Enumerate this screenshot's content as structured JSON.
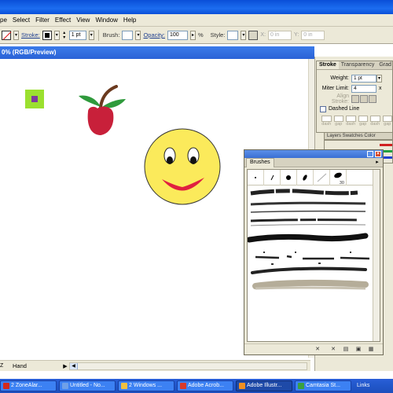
{
  "menu": [
    "pe",
    "Select",
    "Filter",
    "Effect",
    "View",
    "Window",
    "Help"
  ],
  "control_bar": {
    "stroke_label": "Stroke:",
    "stroke_weight": "1 pt",
    "brush_label": "Brush:",
    "opacity_label": "Opacity:",
    "opacity_value": "100",
    "opacity_unit": "%",
    "style_label": "Style:",
    "x_label": "X:",
    "x_value": "0 in",
    "y_label": "Y:",
    "y_value": "0 in"
  },
  "document": {
    "title": "0% (RGB/Preview)"
  },
  "status": {
    "zoom": "Z",
    "tool": "Hand"
  },
  "stroke_panel": {
    "tabs": [
      "Stroke",
      "Transparency",
      "Grad"
    ],
    "weight_label": "Weight:",
    "weight_value": "1 pt",
    "miter_label": "Miter Limit:",
    "miter_value": "4",
    "miter_unit": "x",
    "align_label": "Align Stroke:",
    "dashed_label": "Dashed Line",
    "dash_labels": [
      "dash",
      "gap",
      "dash",
      "gap",
      "dash",
      "gap"
    ]
  },
  "color_strip": {
    "label": "Layers  Swatches  Color"
  },
  "brushes_panel": {
    "tab": "Brushes",
    "first_calligraphic_size": "30",
    "menu_icon": "panel-menu-icon"
  },
  "taskbar": {
    "tasks": [
      {
        "label": "2 ZoneAlar...",
        "color": "#d32a1c",
        "active": false
      },
      {
        "label": "Untitled - No...",
        "color": "#6fa0e8",
        "active": false
      },
      {
        "label": "2 Windows ...",
        "color": "#f0c040",
        "active": false
      },
      {
        "label": "Adobe Acrob...",
        "color": "#d83a2a",
        "active": false
      },
      {
        "label": "Adobe Illustr...",
        "color": "#f09020",
        "active": true
      },
      {
        "label": "Camtasia St...",
        "color": "#3aa040",
        "active": false
      },
      {
        "label": "Links",
        "color": "#6fa0e8",
        "active": false
      }
    ]
  },
  "colors": {
    "title_blue": "#1c6df0",
    "chrome": "#ece9d8",
    "apple_red": "#c8203a",
    "leaf_green": "#2f9a3c",
    "smiley_yellow": "#fbea5b",
    "mouth_red": "#e02040",
    "square_green": "#9be02f",
    "square_purple": "#7d3a9e"
  }
}
